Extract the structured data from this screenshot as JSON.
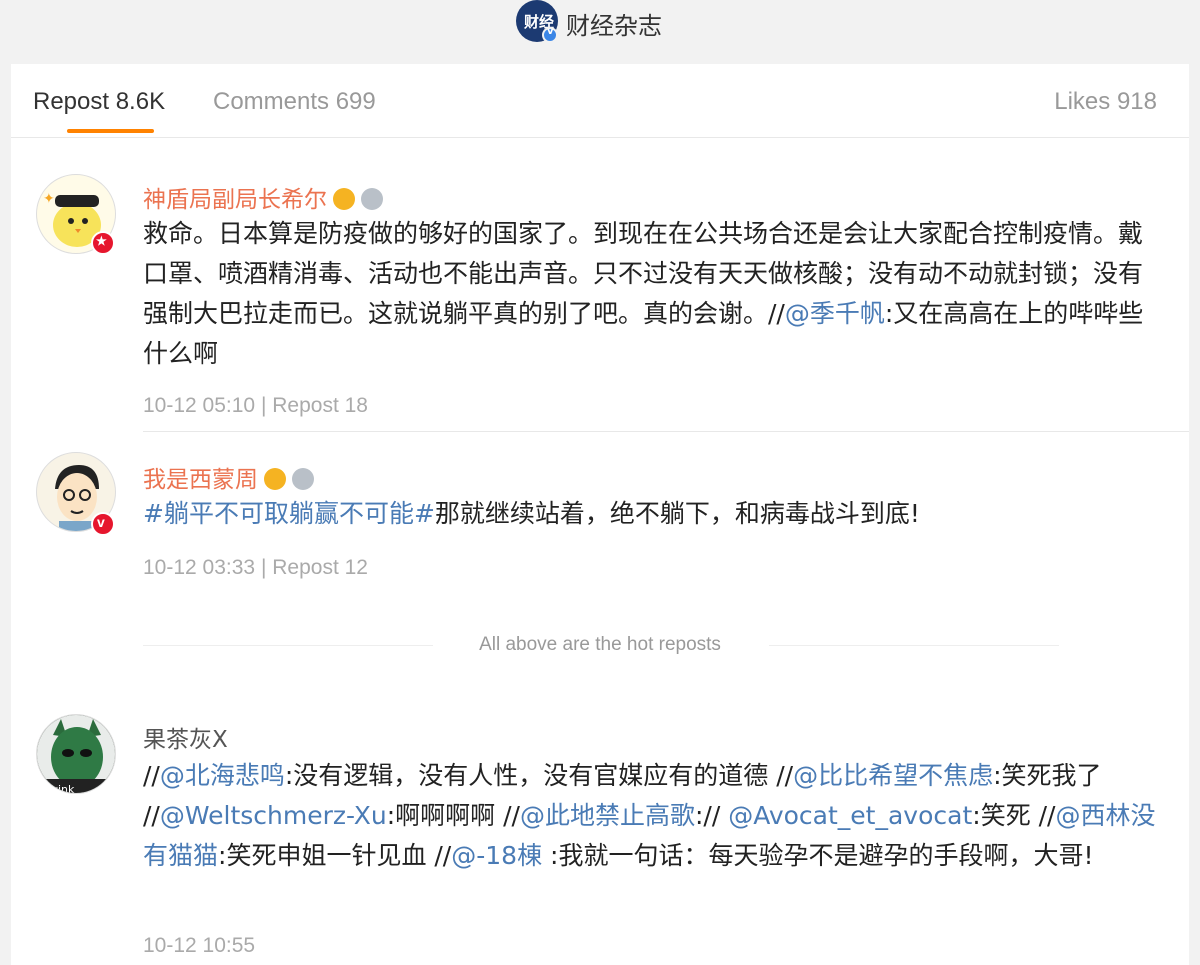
{
  "header": {
    "logo_text": "财经",
    "title": "财经杂志"
  },
  "tabs": {
    "repost": "Repost 8.6K",
    "comments": "Comments 699",
    "likes": "Likes 918"
  },
  "hot_reposts": [
    {
      "username": "神盾局副局长希尔",
      "text_main": "救命。日本算是防疫做的够好的国家了。到现在在公共场合还是会让大家配合控制疫情。戴口罩、喷酒精消毒、活动也不能出声音。只不过没有天天做核酸；没有动不动就封锁；没有强制大巴拉走而已。这就说躺平真的别了吧。真的会谢。//",
      "mention": "@季千帆",
      "text_tail": ":又在高高在上的哔哔些什么啊",
      "time": "10-12 05:10",
      "repost": "Repost 18"
    },
    {
      "username": "我是西蒙周",
      "hashtag": "#躺平不可取躺赢不可能#",
      "text_tail": "那就继续站着，绝不躺下，和病毒战斗到底!",
      "time": "10-12 03:33",
      "repost": "Repost 12"
    }
  ],
  "separator_label": "All above are the hot reposts",
  "reposts": [
    {
      "username": "果茶灰X",
      "avatar_label": "wink",
      "segments": [
        {
          "t": "//",
          "link": false
        },
        {
          "t": "@北海悲鸣",
          "link": true
        },
        {
          "t": ":没有逻辑，没有人性，没有官媒应有的道德 //",
          "link": false
        },
        {
          "t": "@比比希望不焦虑",
          "link": true
        },
        {
          "t": ":笑死我了 //",
          "link": false
        },
        {
          "t": "@Weltschmerz-Xu",
          "link": true
        },
        {
          "t": ":啊啊啊啊 //",
          "link": false
        },
        {
          "t": "@此地禁止高歌",
          "link": true
        },
        {
          "t": ":// ",
          "link": false
        },
        {
          "t": "@Avocat_et_avocat",
          "link": true
        },
        {
          "t": ":笑死 //",
          "link": false
        },
        {
          "t": "@西林没有猫猫",
          "link": true
        },
        {
          "t": ":笑死申姐一针见血 //",
          "link": false
        },
        {
          "t": "@-18棟",
          "link": true
        },
        {
          "t": " :我就一句话：每天验孕不是避孕的手段啊，大哥!",
          "link": false
        }
      ],
      "time": "10-12 10:55"
    }
  ],
  "colors": {
    "accent": "#ff8200",
    "username_orange": "#eb7350",
    "link": "#4a7bb5",
    "vip_red": "#e6162d"
  }
}
